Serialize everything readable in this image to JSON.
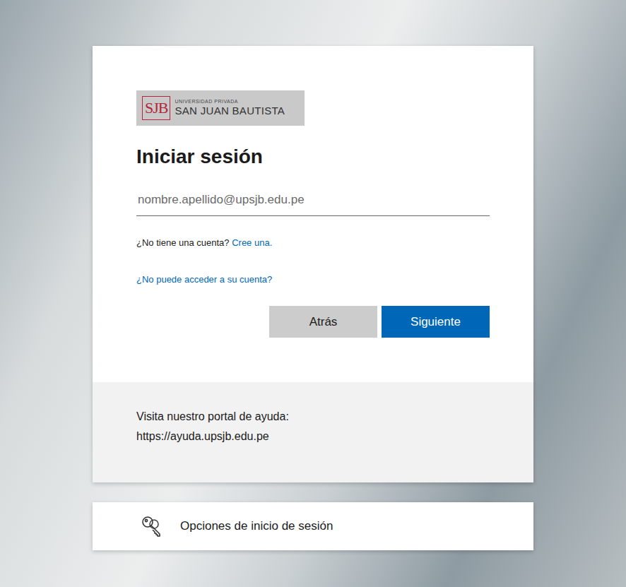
{
  "logo": {
    "mark": "SJB",
    "subtitle": "UNIVERSIDAD PRIVADA",
    "name": "SAN JUAN BAUTISTA"
  },
  "title": "Iniciar sesión",
  "email": {
    "placeholder": "nombre.apellido@upsjb.edu.pe"
  },
  "signup": {
    "prompt": "¿No tiene una cuenta?",
    "link": "Cree una."
  },
  "help_link": "¿No puede acceder a su cuenta?",
  "buttons": [
    {
      "label": "Atrás",
      "kind": "secondary"
    },
    {
      "label": "Siguiente",
      "kind": "primary"
    }
  ],
  "footer": {
    "lines": [
      "Visita nuestro portal de ayuda:",
      "https://ayuda.upsjb.edu.pe"
    ]
  },
  "options": {
    "label": "Opciones de inicio de sesión"
  }
}
